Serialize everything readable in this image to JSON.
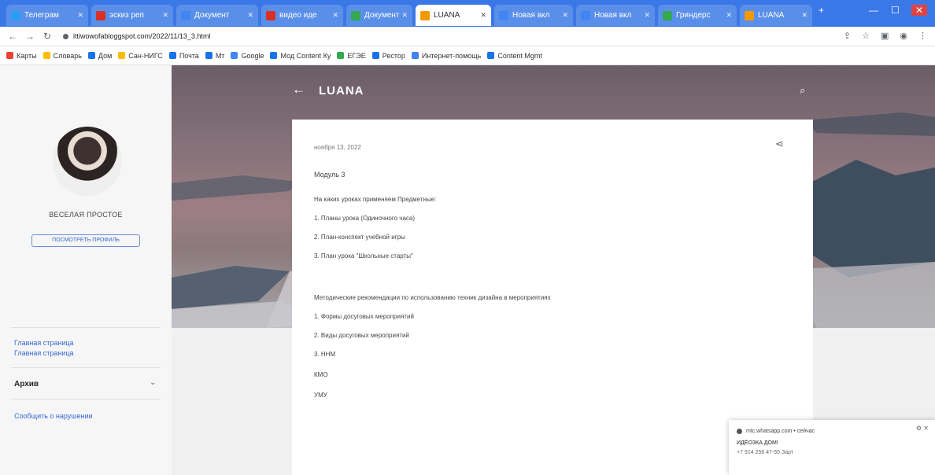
{
  "browser": {
    "tabs": [
      {
        "label": "Телеграм",
        "color": "#2a9df4"
      },
      {
        "label": "эскиз реп",
        "color": "#d93025"
      },
      {
        "label": "Документ",
        "color": "#4285f4"
      },
      {
        "label": "видео иде",
        "color": "#d93025"
      },
      {
        "label": "Документ",
        "color": "#34a853"
      },
      {
        "label": "LUANA",
        "color": "#f29900",
        "active": true
      },
      {
        "label": "Новая вкл",
        "color": "#4285f4"
      },
      {
        "label": "Новая вкл",
        "color": "#4285f4"
      },
      {
        "label": "Гриндерс",
        "color": "#34a853"
      },
      {
        "label": "LUANA",
        "color": "#f29900"
      }
    ],
    "url": "ittiwowofabloggspot.com/2022/11/13_3.html",
    "bookmarks": [
      {
        "label": "Карты",
        "color": "#ea4335"
      },
      {
        "label": "Словарь",
        "color": "#fbbc04"
      },
      {
        "label": "Дом",
        "color": "#1a73e8"
      },
      {
        "label": "Сан-НИГС",
        "color": "#fbbc04"
      },
      {
        "label": "Почта",
        "color": "#1a73e8"
      },
      {
        "label": "Мт",
        "color": "#1a73e8"
      },
      {
        "label": "Google",
        "color": "#4285f4"
      },
      {
        "label": "Мод Content Ку",
        "color": "#1a73e8"
      },
      {
        "label": "ЕГЭЕ",
        "color": "#34a853"
      },
      {
        "label": "Рестор",
        "color": "#1a73e8"
      },
      {
        "label": "Интернет-помощь",
        "color": "#4285f4"
      },
      {
        "label": "Content Mgmt",
        "color": "#1a73e8"
      }
    ]
  },
  "sidebar": {
    "profile_name": "ВЕСЕЛАЯ ПРОСТОЕ",
    "profile_button": "ПОСМОТРЕТЬ ПРОФИЛЬ",
    "links": [
      "Главная страница",
      "Главная страница"
    ],
    "archive_label": "Архив",
    "report_link": "Сообщить о нарушении"
  },
  "header": {
    "blog_title": "LUANA"
  },
  "post": {
    "date": "ноября 13, 2022",
    "lines": [
      "Модуль 3",
      "На каких уроках применяем Предметные:",
      "1. Планы урока (Одиночного часа)",
      "2. План-конспект учебной игры",
      "3. План урока \"Школьные старты\"",
      "Методические рекомендации по использованию техник дизайна в мероприятиях",
      "1. Формы досуговых мероприятий",
      "2. Виды досуговых мероприятий",
      "3. ННМ",
      "КМО",
      "УМУ"
    ]
  },
  "notification": {
    "source": "mtc.whatsapp.com • сейчас",
    "title": "ИДЁОЗКА ДОМ!",
    "subtitle": "+7 914 256 47-55 Зарт"
  }
}
